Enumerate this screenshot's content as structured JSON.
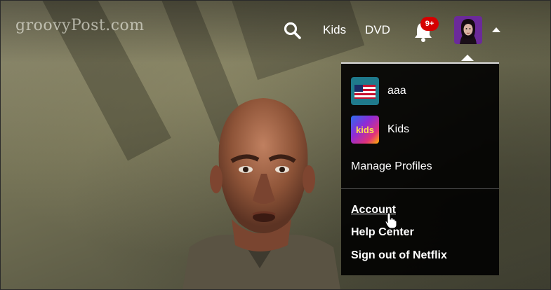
{
  "watermark": "groovyPost.com",
  "nav": {
    "search_icon": "search-icon",
    "kids_label": "Kids",
    "dvd_label": "DVD",
    "notifications_icon": "bell-icon",
    "notifications_badge": "9+",
    "profile_icon": "avatar",
    "caret_icon": "caret-up-icon"
  },
  "menu": {
    "profiles": [
      {
        "name": "aaa",
        "icon": "profile-avatar-stripes"
      },
      {
        "name": "Kids",
        "icon": "profile-avatar-kids"
      }
    ],
    "manage_profiles": "Manage Profiles",
    "account": "Account",
    "help_center": "Help Center",
    "sign_out": "Sign out of Netflix"
  },
  "colors": {
    "badge": "#d60000",
    "menu_bg": "#000000",
    "text": "#ffffff"
  }
}
